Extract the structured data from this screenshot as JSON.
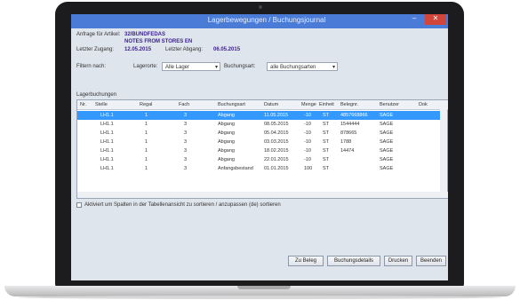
{
  "window": {
    "title": "Lagerbewegungen / Buchungsjournal",
    "min_glyph": "–",
    "close_glyph": "✕"
  },
  "info": {
    "anfrage_label": "Anfrage für Artikel:",
    "article_code": "32/BUNDFEDAS",
    "article_desc": "NOTES FROM STORES EN",
    "letzter_zugang_label": "Letzter Zugang:",
    "letzter_zugang_value": "12.05.2015",
    "letzter_abgang_label": "Letzter Abgang:",
    "letzter_abgang_value": "06.05.2015"
  },
  "filter": {
    "label": "Filtern nach:",
    "lagerorte_label": "Lagerorte:",
    "lagerorte_value": "Alle Lager",
    "buchungsart_label": "Buchungsart:",
    "buchungsart_value": "alle Buchungsarten"
  },
  "grid": {
    "section_label": "Lagerbuchungen",
    "columns": [
      "Nr.",
      "Stelle",
      "Regal",
      "Fach",
      "Buchungsart",
      "Datum",
      "Menge",
      "Einheit",
      "Belegnr.",
      "Benutzer",
      "Dok"
    ],
    "rows": [
      {
        "nr": "",
        "stelle": "LH1.1",
        "regal": "1",
        "fach": "3",
        "art": "Abgang",
        "datum": "11.05.2015",
        "menge": "-10",
        "einheit": "ST",
        "beleg": "4857668866",
        "benutzer": "SAGE"
      },
      {
        "nr": "",
        "stelle": "LH1.1",
        "regal": "1",
        "fach": "3",
        "art": "Abgang",
        "datum": "08.05.2015",
        "menge": "-10",
        "einheit": "ST",
        "beleg": "1544444",
        "benutzer": "SAGE"
      },
      {
        "nr": "",
        "stelle": "LH1.1",
        "regal": "1",
        "fach": "3",
        "art": "Abgang",
        "datum": "05.04.2015",
        "menge": "-10",
        "einheit": "ST",
        "beleg": "878665",
        "benutzer": "SAGE"
      },
      {
        "nr": "",
        "stelle": "LH1.1",
        "regal": "1",
        "fach": "3",
        "art": "Abgang",
        "datum": "03.03.2015",
        "menge": "-10",
        "einheit": "ST",
        "beleg": "1788",
        "benutzer": "SAGE"
      },
      {
        "nr": "",
        "stelle": "LH1.1",
        "regal": "1",
        "fach": "3",
        "art": "Abgang",
        "datum": "18.02.2015",
        "menge": "-10",
        "einheit": "ST",
        "beleg": "14474",
        "benutzer": "SAGE"
      },
      {
        "nr": "",
        "stelle": "LH1.1",
        "regal": "1",
        "fach": "3",
        "art": "Abgang",
        "datum": "22.01.2015",
        "menge": "-10",
        "einheit": "ST",
        "beleg": "",
        "benutzer": "SAGE"
      },
      {
        "nr": "",
        "stelle": "LH1.1",
        "regal": "1",
        "fach": "3",
        "art": "Anfangsbestand",
        "datum": "01.01.2015",
        "menge": "100",
        "einheit": "ST",
        "beleg": "",
        "benutzer": "SAGE"
      }
    ],
    "row_marker": "▸"
  },
  "checkbox_label": "Aktiviert um Spalten in der Tabellenansicht zu sortieren / anzupassen (de) sortieren",
  "buttons": {
    "zu_beleg": "Zu Beleg",
    "buchungsdetails": "Buchungsdetails",
    "drucken": "Drucken",
    "beenden": "Beenden"
  }
}
